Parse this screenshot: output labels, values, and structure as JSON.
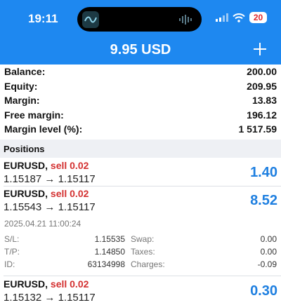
{
  "status": {
    "time": "19:11",
    "battery": "20",
    "island_app_icon": "trading-app-icon",
    "island_activity_icon": "audio-wave-icon"
  },
  "header": {
    "title": "9.95 USD",
    "add_icon": "plus-icon"
  },
  "summary": [
    {
      "label": "Balance:",
      "value": "200.00"
    },
    {
      "label": "Equity:",
      "value": "209.95"
    },
    {
      "label": "Margin:",
      "value": "13.83"
    },
    {
      "label": "Free margin:",
      "value": "196.12"
    },
    {
      "label": "Margin level (%):",
      "value": "1 517.59"
    }
  ],
  "positions_title": "Positions",
  "positions": [
    {
      "symbol": "EURUSD,",
      "side": "sell 0.02",
      "open": "1.15187",
      "arrow": "→",
      "current": "1.15117",
      "profit": "1.40"
    },
    {
      "symbol": "EURUSD,",
      "side": "sell 0.02",
      "open": "1.15543",
      "arrow": "→",
      "current": "1.15117",
      "profit": "8.52"
    },
    {
      "symbol": "EURUSD,",
      "side": "sell 0.02",
      "open": "1.15132",
      "arrow": "→",
      "current": "1.15117",
      "profit": "0.30"
    }
  ],
  "details": {
    "date": "2025.04.21 11:00:24",
    "rows": [
      {
        "l1": "S/L:",
        "v1": "1.15535",
        "l2": "Swap:",
        "v2": "0.00"
      },
      {
        "l1": "T/P:",
        "v1": "1.14850",
        "l2": "Taxes:",
        "v2": "0.00"
      },
      {
        "l1": "ID:",
        "v1": "63134998",
        "l2": "Charges:",
        "v2": "-0.09"
      }
    ]
  },
  "colors": {
    "header": "#1e88f0",
    "sell": "#d32f2f",
    "profit": "#1e7fe0"
  }
}
